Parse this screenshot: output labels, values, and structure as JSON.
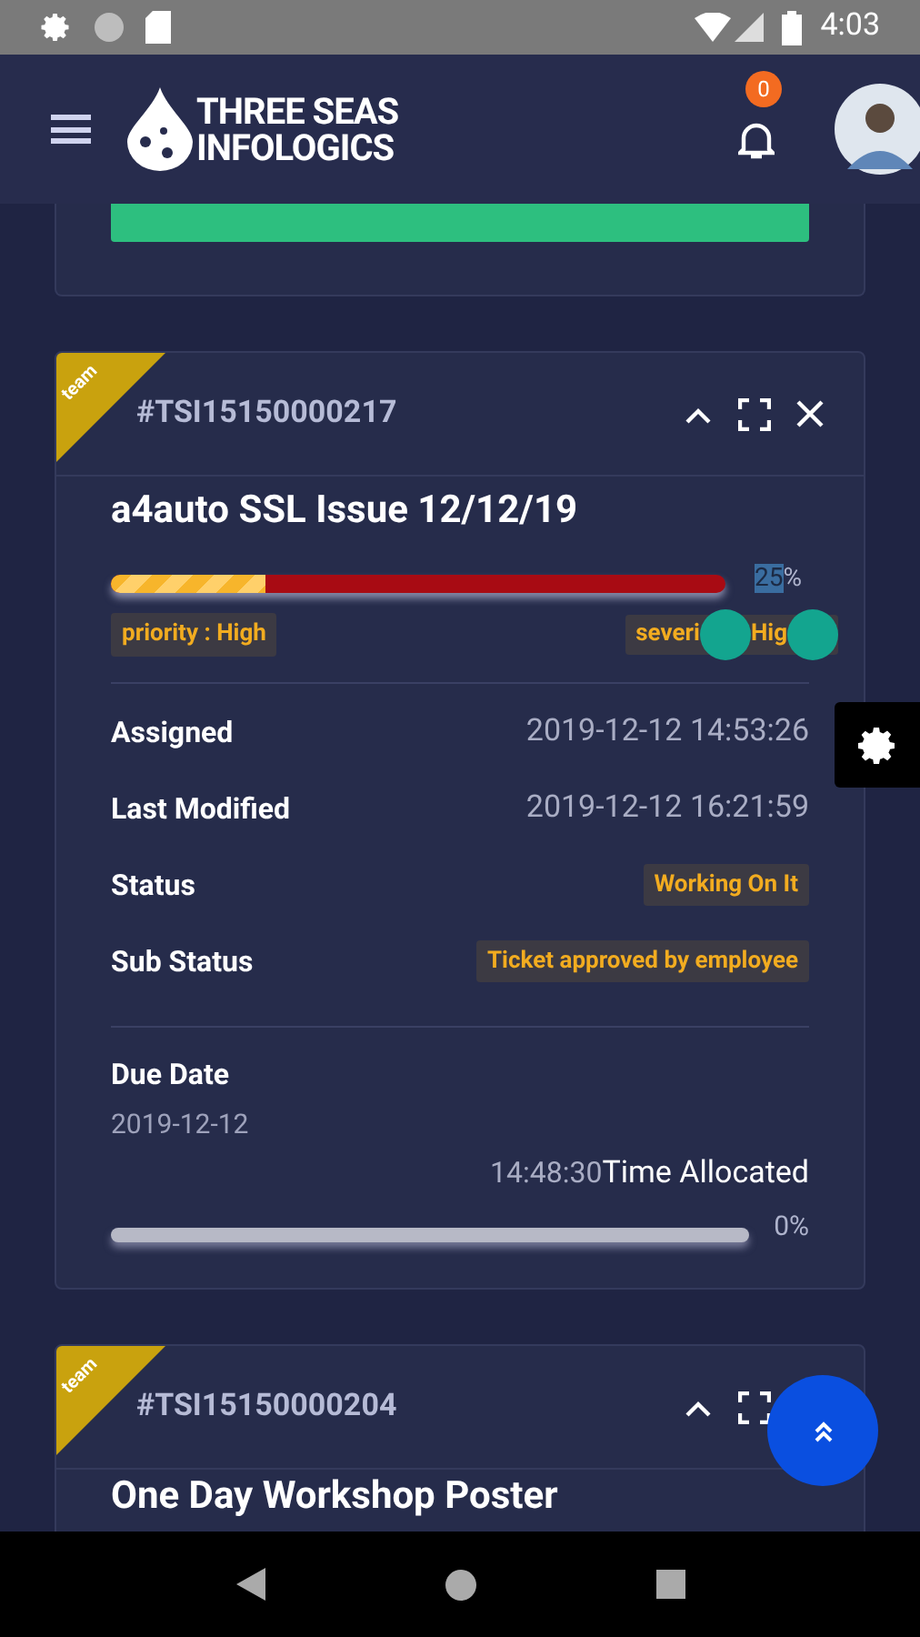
{
  "status_bar": {
    "time": "4:03"
  },
  "header": {
    "brand_line_1": "THREE SEAS",
    "brand_line_2": "INFOLOGICS",
    "notification_count": "0"
  },
  "tickets": [
    {
      "ribbon": "team",
      "id": "#TSI15150000217",
      "title": "a4auto SSL Issue 12/12/19",
      "progress": {
        "level": 0.25,
        "reading_highlight": "25",
        "reading_rest": "%"
      },
      "priority": "priority : High",
      "severity_parts": [
        "severi",
        "Hig"
      ],
      "fields": [
        {
          "label": "Assigned",
          "value": "2019-12-12 14:53:26",
          "kind": "plain"
        },
        {
          "label": "Last Modified",
          "value": "2019-12-12 16:21:59",
          "kind": "plain"
        },
        {
          "label": "Status",
          "value": "Working On It",
          "kind": "badge"
        },
        {
          "label": "Sub Status",
          "value": "Ticket approved by employee",
          "kind": "badge"
        }
      ],
      "due_label": "Due Date",
      "due_date": "2019-12-12",
      "time_value": "14:48:30",
      "time_label": "Time Allocated",
      "time_progress": {
        "level": 0,
        "reading": "0%"
      }
    },
    {
      "ribbon": "team",
      "id": "#TSI15150000204",
      "title": "One Day Workshop Poster"
    }
  ]
}
